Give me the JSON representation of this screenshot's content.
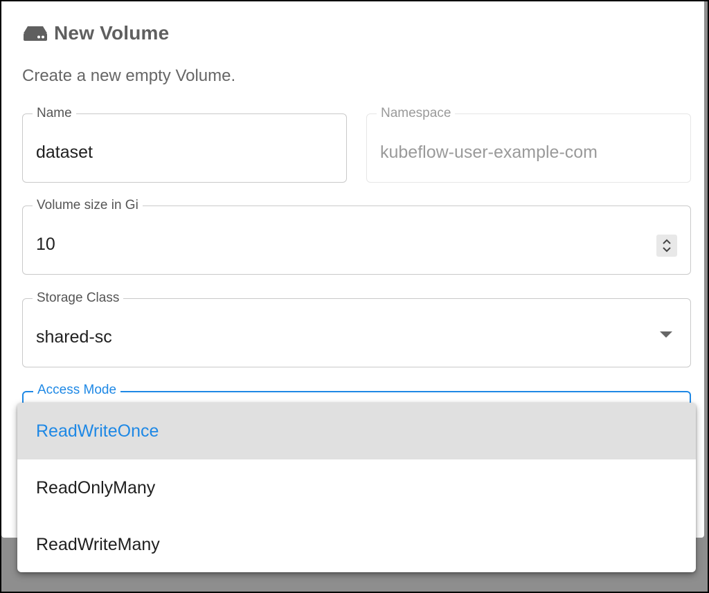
{
  "dialog": {
    "title": "New Volume",
    "icon": "storage-icon",
    "subtitle": "Create a new empty Volume."
  },
  "form": {
    "name": {
      "label": "Name",
      "value": "dataset"
    },
    "namespace": {
      "label": "Namespace",
      "value": "kubeflow-user-example-com",
      "disabled": true
    },
    "size": {
      "label": "Volume size in Gi",
      "value": "10"
    },
    "storage_class": {
      "label": "Storage Class",
      "value": "shared-sc"
    },
    "access_mode": {
      "label": "Access Mode",
      "focused": true
    }
  },
  "access_mode_menu": {
    "options": [
      {
        "label": "ReadWriteOnce",
        "selected": true
      },
      {
        "label": "ReadOnlyMany",
        "selected": false
      },
      {
        "label": "ReadWriteMany",
        "selected": false
      }
    ]
  },
  "colors": {
    "accent": "#1e88e5",
    "title_text": "#5f5f5f",
    "overlay_backdrop": "#8e8e8e",
    "selected_option_bg": "#e0e0e0"
  }
}
